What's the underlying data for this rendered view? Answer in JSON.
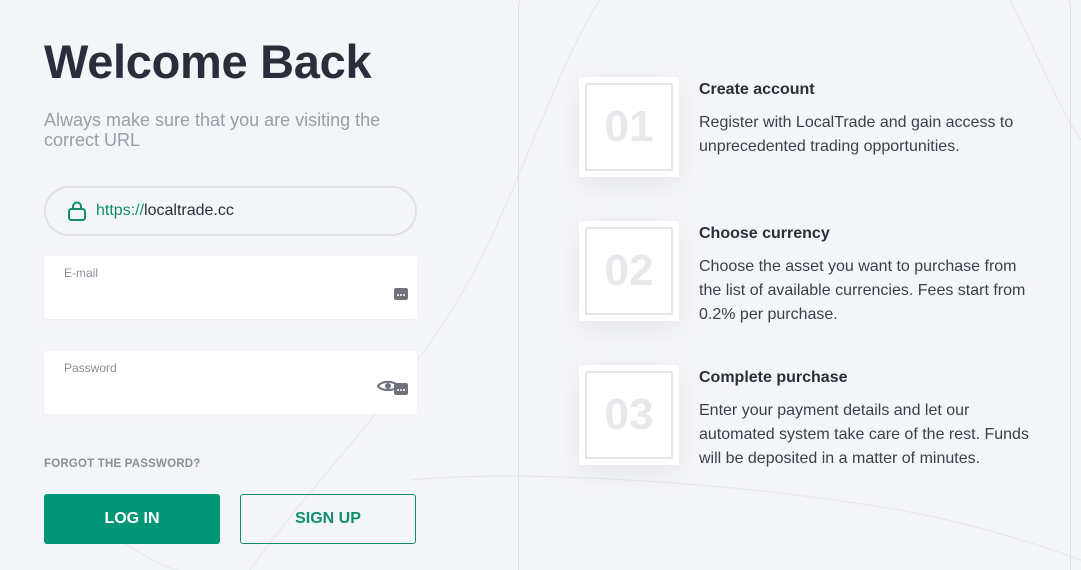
{
  "login": {
    "title": "Welcome Back",
    "subtitle": "Always make sure that you are visiting the correct URL",
    "url_protocol": "https://",
    "url_host": "localtrade.cc",
    "email": {
      "label": "E-mail",
      "value": ""
    },
    "password": {
      "label": "Password",
      "value": ""
    },
    "forgot_label": "FORGOT THE PASSWORD?",
    "login_label": "LOG IN",
    "signup_label": "SIGN UP"
  },
  "steps": [
    {
      "number": "01",
      "title": "Create account",
      "description": "Register with LocalTrade and gain access to unprecedented trading opportunities."
    },
    {
      "number": "02",
      "title": "Choose currency",
      "description": "Choose the asset you want to purchase from the list of available currencies. Fees start from 0.2% per purchase."
    },
    {
      "number": "03",
      "title": "Complete purchase",
      "description": "Enter your payment details and let our automated system take care of the rest. Funds will be deposited in a matter of minutes."
    }
  ],
  "icons": {
    "lock": "lock-icon",
    "eye": "eye-icon",
    "keyboard": "keyboard-icon"
  },
  "colors": {
    "accent": "#009676",
    "background": "#f4f5f8",
    "text": "#2b2d3a",
    "muted": "#9a9ca6"
  }
}
